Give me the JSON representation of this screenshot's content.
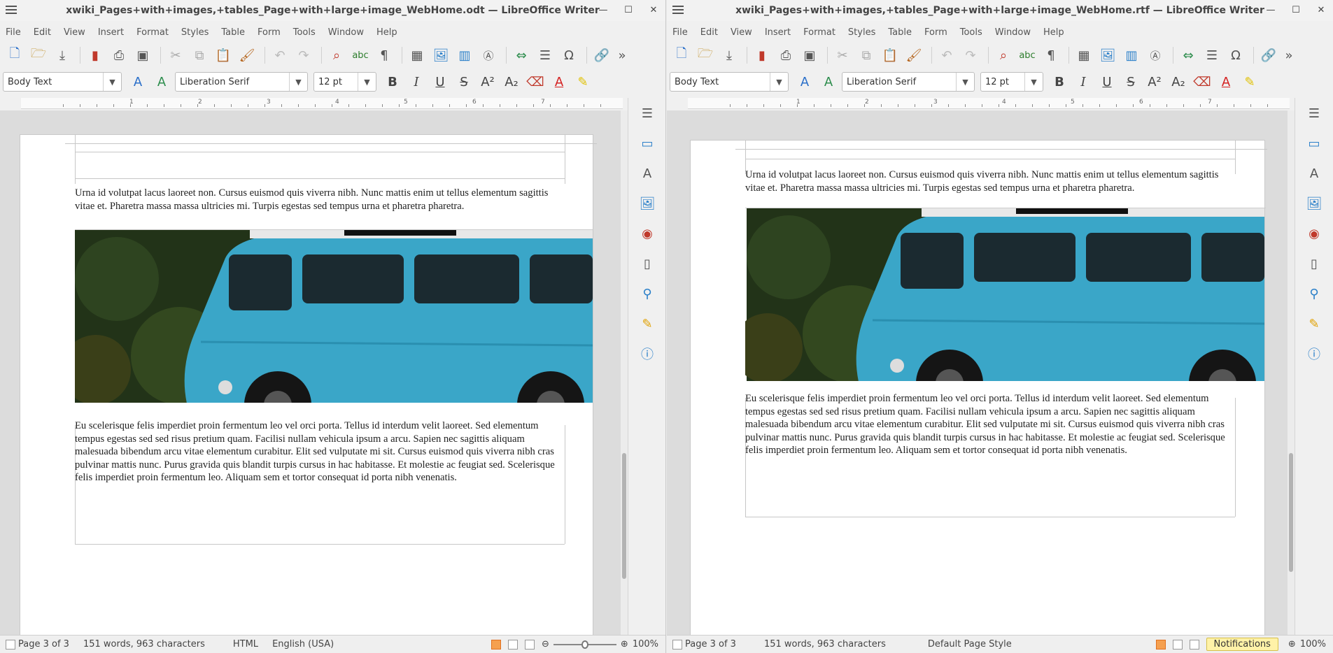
{
  "left": {
    "title": "xwiki_Pages+with+images,+tables_Page+with+large+image_WebHome.odt — LibreOffice Writer",
    "menu": [
      "File",
      "Edit",
      "View",
      "Insert",
      "Format",
      "Styles",
      "Table",
      "Form",
      "Tools",
      "Window",
      "Help"
    ],
    "para_style": "Body Text",
    "font_name": "Liberation Serif",
    "font_size": "12 pt",
    "para1": "Urna id volutpat lacus laoreet non. Cursus euismod quis viverra nibh. Nunc mattis enim ut tellus elementum sagittis vitae et. Pharetra massa massa ultricies mi. Turpis egestas sed tempus urna et pharetra pharetra.",
    "para2": "Eu scelerisque felis imperdiet proin fermentum leo vel orci porta. Tellus id interdum velit laoreet. Sed elementum tempus egestas sed sed risus pretium quam. Facilisi nullam vehicula ipsum a arcu. Sapien nec sagittis aliquam malesuada bibendum arcu vitae elementum curabitur. Elit sed vulputate mi sit. Cursus euismod quis viverra nibh cras pulvinar mattis nunc. Purus gravida quis blandit turpis cursus in hac habitasse. Et molestie ac feugiat sed. Scelerisque felis imperdiet proin fermentum leo. Aliquam sem et tortor consequat id porta nibh venenatis.",
    "status": {
      "page": "Page 3 of 3",
      "words": "151 words, 963 characters",
      "mode": "HTML",
      "language": "English (USA)",
      "zoom": "100%"
    }
  },
  "right": {
    "title": "xwiki_Pages+with+images,+tables_Page+with+large+image_WebHome.rtf — LibreOffice Writer",
    "menu": [
      "File",
      "Edit",
      "View",
      "Insert",
      "Format",
      "Styles",
      "Table",
      "Form",
      "Tools",
      "Window",
      "Help"
    ],
    "para_style": "Body Text",
    "font_name": "Liberation Serif",
    "font_size": "12 pt",
    "para1": "Urna id volutpat lacus laoreet non. Cursus euismod quis viverra nibh. Nunc mattis enim ut tellus elementum sagittis vitae et. Pharetra massa massa ultricies mi. Turpis egestas sed tempus urna et pharetra pharetra.",
    "para2": "Eu scelerisque felis imperdiet proin fermentum leo vel orci porta. Tellus id interdum velit laoreet. Sed elementum tempus egestas sed sed risus pretium quam. Facilisi nullam vehicula ipsum a arcu. Sapien nec sagittis aliquam malesuada bibendum arcu vitae elementum curabitur. Elit sed vulputate mi sit. Cursus euismod quis viverra nibh cras pulvinar mattis nunc. Purus gravida quis blandit turpis cursus in hac habitasse. Et molestie ac feugiat sed. Scelerisque felis imperdiet proin fermentum leo. Aliquam sem et tortor consequat id porta nibh venenatis.",
    "status": {
      "page": "Page 3 of 3",
      "words": "151 words, 963 characters",
      "page_style": "Default Page Style",
      "notifications": "Notifications",
      "zoom": "100%"
    }
  },
  "ruler_numbers": [
    "1",
    "2",
    "3",
    "4",
    "5",
    "6",
    "7"
  ],
  "colors": {
    "van_blue": "#3aa6c8",
    "foliage": "#223318",
    "font_color_red": "#d42020",
    "highlight_yellow": "#f5e000"
  },
  "toolbar_icons": [
    "new-icon",
    "open-icon",
    "save-icon",
    "export-pdf-icon",
    "print-icon",
    "print-preview-icon",
    "cut-icon",
    "copy-icon",
    "paste-icon",
    "clone-format-icon",
    "undo-icon",
    "redo-icon",
    "find-replace-icon",
    "spellcheck-icon",
    "formatting-marks-icon",
    "insert-table-icon",
    "insert-image-icon",
    "insert-chart-icon",
    "insert-textbox-icon",
    "insert-pagebreak-icon",
    "insert-field-icon",
    "special-character-icon",
    "hyperlink-icon"
  ]
}
